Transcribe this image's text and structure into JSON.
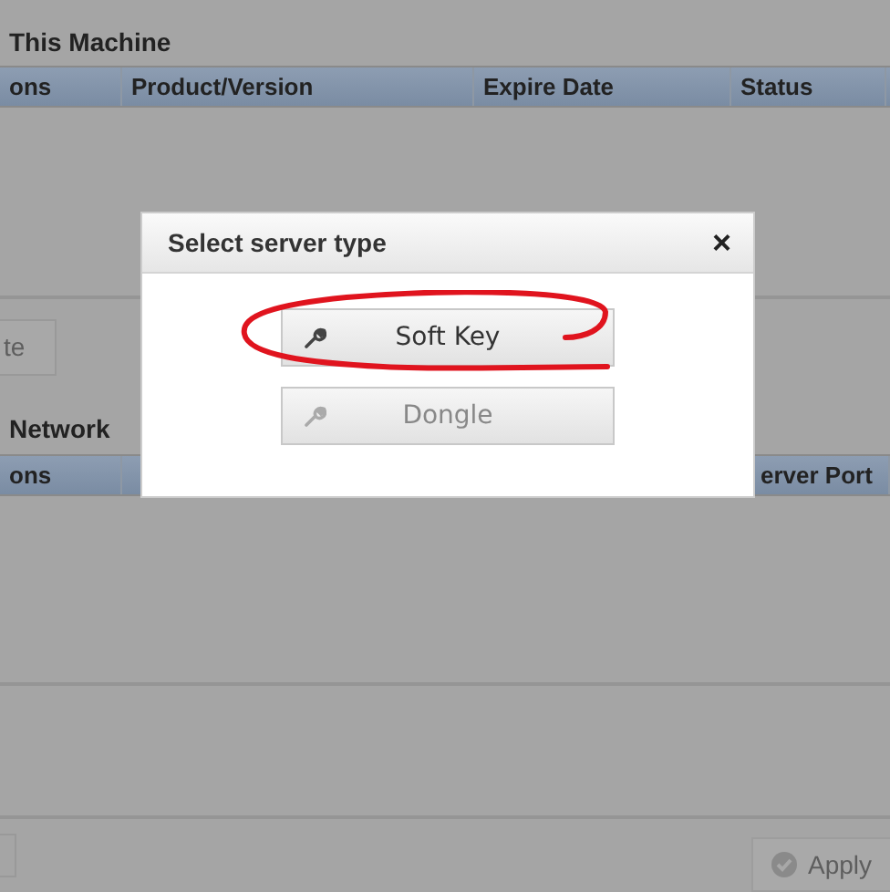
{
  "sections": [
    {
      "title": "This Machine",
      "columns": [
        "ons",
        "Product/Version",
        "Expire Date",
        "Status"
      ]
    },
    {
      "title": "Network",
      "columns": [
        "ons",
        "",
        "",
        "erver Port"
      ]
    }
  ],
  "side_button": "te",
  "footer": {
    "apply_button": "Apply"
  },
  "dialog": {
    "title": "Select server type",
    "close": "×",
    "buttons": [
      {
        "label": "Soft Key",
        "disabled": false,
        "highlighted": true
      },
      {
        "label": "Dongle",
        "disabled": true,
        "highlighted": false
      }
    ]
  }
}
